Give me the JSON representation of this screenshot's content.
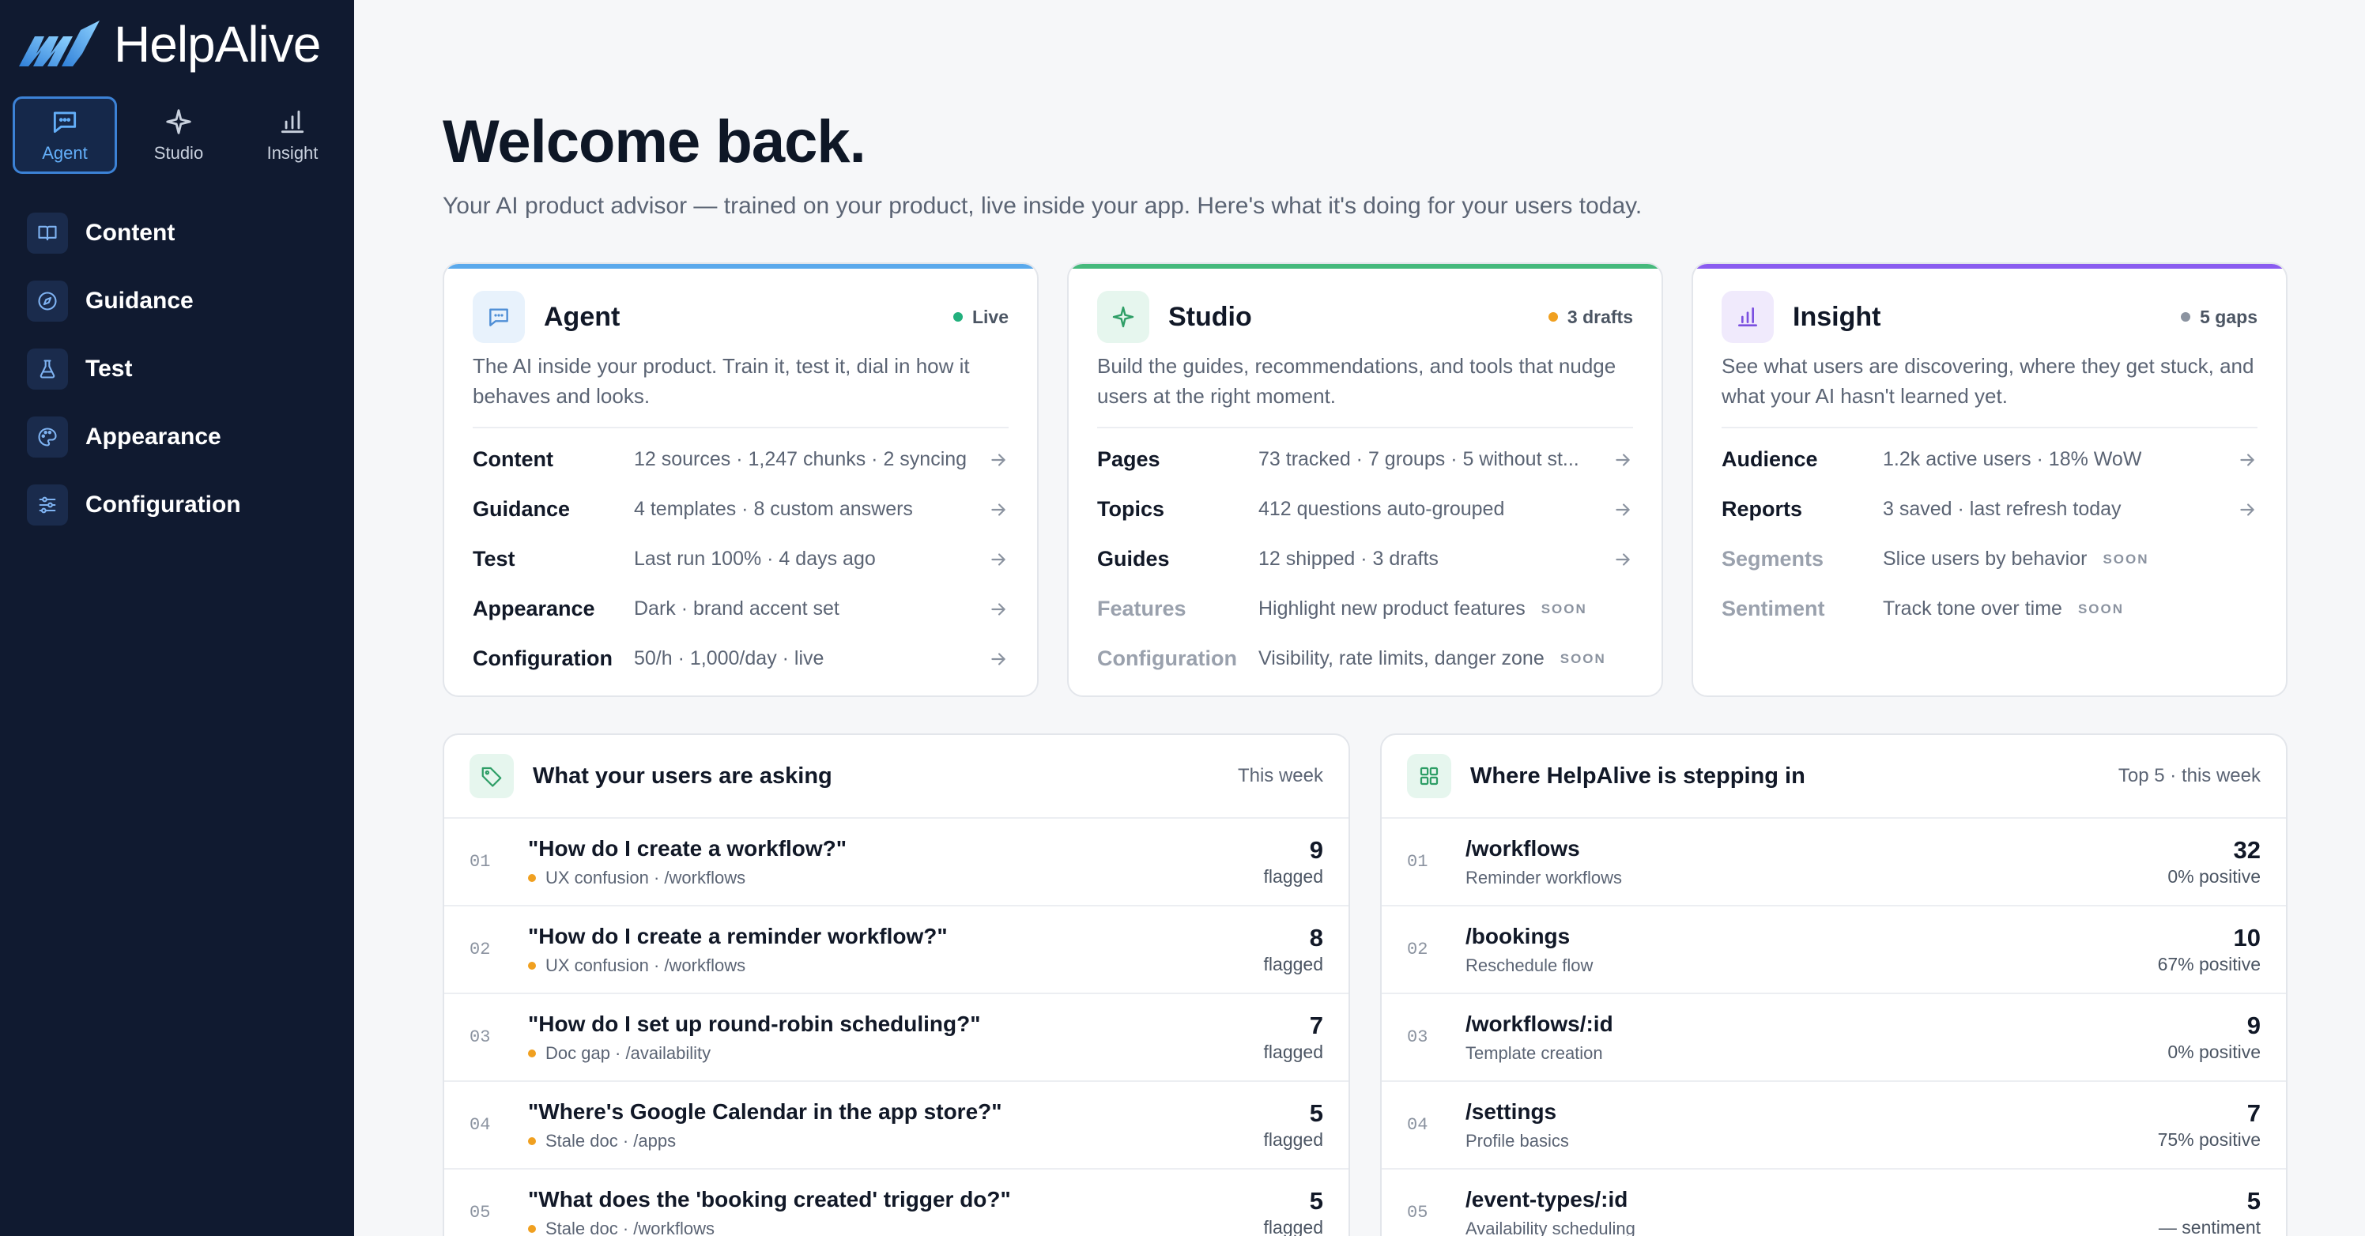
{
  "brand": {
    "name": "HelpAlive"
  },
  "modes": [
    {
      "label": "Agent",
      "icon": "chat-bubble-icon",
      "active": true
    },
    {
      "label": "Studio",
      "icon": "sparkle-icon",
      "active": false
    },
    {
      "label": "Insight",
      "icon": "bar-chart-icon",
      "active": false
    }
  ],
  "nav": [
    {
      "label": "Content",
      "icon": "book-icon"
    },
    {
      "label": "Guidance",
      "icon": "compass-icon"
    },
    {
      "label": "Test",
      "icon": "flask-icon"
    },
    {
      "label": "Appearance",
      "icon": "palette-icon"
    },
    {
      "label": "Configuration",
      "icon": "sliders-icon"
    }
  ],
  "header": {
    "title": "Welcome back.",
    "subtitle": "Your AI product advisor — trained on your product, live inside your app. Here's what it's doing for your users today."
  },
  "cards": [
    {
      "title": "Agent",
      "icon": "chat-bubble-icon",
      "accent": "#5aa9ec",
      "icon_bg": "#e8f2fc",
      "icon_color": "#4f8fd6",
      "status": "Live",
      "status_color": "#22b07d",
      "description": "The AI inside your product. Train it, test it, dial in how it behaves and looks.",
      "rows": [
        {
          "key": "Content",
          "value": "12 sources · 1,247 chunks · 2 syncing"
        },
        {
          "key": "Guidance",
          "value": "4 templates · 8 custom answers"
        },
        {
          "key": "Test",
          "value": "Last run 100% · 4 days ago"
        },
        {
          "key": "Appearance",
          "value": "Dark · brand accent set"
        },
        {
          "key": "Configuration",
          "value": "50/h · 1,000/day · live"
        }
      ]
    },
    {
      "title": "Studio",
      "icon": "sparkle-icon",
      "accent": "#45b97c",
      "icon_bg": "#e6f6ee",
      "icon_color": "#2e9e66",
      "status": "3 drafts",
      "status_color": "#f0a020",
      "description": "Build the guides, recommendations, and tools that nudge users at the right moment.",
      "rows": [
        {
          "key": "Pages",
          "value": "73 tracked · 7 groups · 5 without st..."
        },
        {
          "key": "Topics",
          "value": "412 questions auto-grouped"
        },
        {
          "key": "Guides",
          "value": "12 shipped · 3 drafts"
        },
        {
          "key": "Features",
          "value": "Highlight new product features",
          "soon": "SOON"
        },
        {
          "key": "Configuration",
          "value": "Visibility, rate limits, danger zone",
          "soon": "SOON"
        }
      ]
    },
    {
      "title": "Insight",
      "icon": "bar-chart-icon",
      "accent": "#8a5cf0",
      "icon_bg": "#f0eafc",
      "icon_color": "#7b50e0",
      "status": "5 gaps",
      "status_color": "#8b93a0",
      "description": "See what users are discovering, where they get stuck, and what your AI hasn't learned yet.",
      "rows": [
        {
          "key": "Audience",
          "value": "1.2k active users · 18% WoW"
        },
        {
          "key": "Reports",
          "value": "3 saved · last refresh today"
        },
        {
          "key": "Segments",
          "value": "Slice users by behavior",
          "soon": "SOON"
        },
        {
          "key": "Sentiment",
          "value": "Track tone over time",
          "soon": "SOON"
        }
      ]
    }
  ],
  "asking": {
    "title": "What your users are asking",
    "meta": "This week",
    "icon": "tag-icon",
    "rows": [
      {
        "num": "01",
        "title": "\"How do I create a workflow?\"",
        "sub": "UX confusion · /workflows",
        "count": "9",
        "label": "flagged"
      },
      {
        "num": "02",
        "title": "\"How do I create a reminder workflow?\"",
        "sub": "UX confusion · /workflows",
        "count": "8",
        "label": "flagged"
      },
      {
        "num": "03",
        "title": "\"How do I set up round-robin scheduling?\"",
        "sub": "Doc gap · /availability",
        "count": "7",
        "label": "flagged"
      },
      {
        "num": "04",
        "title": "\"Where's Google Calendar in the app store?\"",
        "sub": "Stale doc · /apps",
        "count": "5",
        "label": "flagged"
      },
      {
        "num": "05",
        "title": "\"What does the 'booking created' trigger do?\"",
        "sub": "Stale doc · /workflows",
        "count": "5",
        "label": "flagged"
      }
    ]
  },
  "stepping": {
    "title": "Where HelpAlive is stepping in",
    "meta": "Top 5 · this week",
    "icon": "grid-icon",
    "rows": [
      {
        "num": "01",
        "title": "/workflows",
        "sub": "Reminder workflows",
        "count": "32",
        "label": "0% positive"
      },
      {
        "num": "02",
        "title": "/bookings",
        "sub": "Reschedule flow",
        "count": "10",
        "label": "67% positive"
      },
      {
        "num": "03",
        "title": "/workflows/:id",
        "sub": "Template creation",
        "count": "9",
        "label": "0% positive"
      },
      {
        "num": "04",
        "title": "/settings",
        "sub": "Profile basics",
        "count": "7",
        "label": "75% positive"
      },
      {
        "num": "05",
        "title": "/event-types/:id",
        "sub": "Availability scheduling",
        "count": "5",
        "label": "— sentiment"
      }
    ]
  },
  "colors": {
    "sidebar": "#101a30",
    "tag_dot": "#f0a020"
  }
}
